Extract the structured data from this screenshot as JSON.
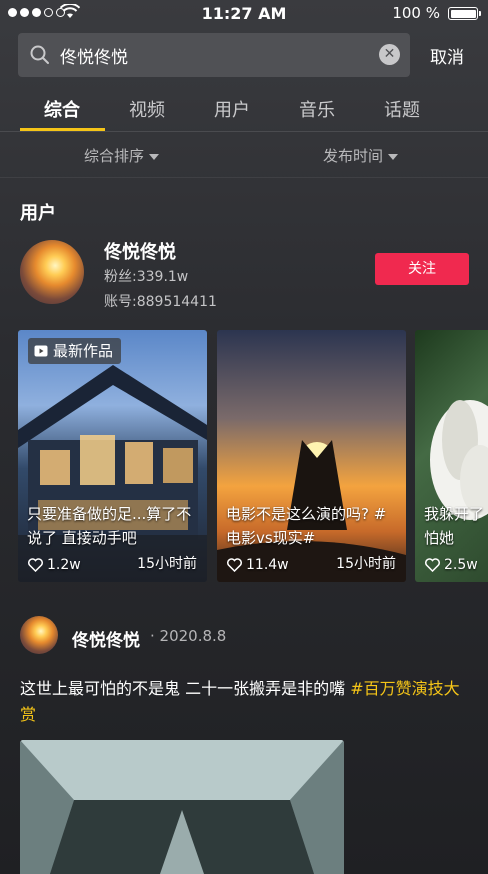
{
  "status_bar": {
    "time": "11:27 AM",
    "battery": "100 %"
  },
  "search": {
    "query": "佟悦佟悦",
    "cancel_label": "取消"
  },
  "tabs": [
    {
      "label": "综合",
      "active": true
    },
    {
      "label": "视频",
      "active": false
    },
    {
      "label": "用户",
      "active": false
    },
    {
      "label": "音乐",
      "active": false
    },
    {
      "label": "话题",
      "active": false
    }
  ],
  "filters": {
    "sort_label": "综合排序",
    "time_label": "发布时间"
  },
  "users_section": {
    "title": "用户",
    "user": {
      "name": "佟悦佟悦",
      "fans": "粉丝:339.1w",
      "account": "账号:889514411",
      "follow_label": "关注"
    }
  },
  "video_cards": [
    {
      "badge": "最新作品",
      "caption": "只要准备做的足...算了不说了 直接动手吧",
      "likes": "1.2w",
      "ago": "15小时前"
    },
    {
      "caption": "电影不是这么演的吗? #电影vs现实#",
      "likes": "11.4w",
      "ago": "15小时前"
    },
    {
      "caption": "我躲开了怕她",
      "likes": "2.5w",
      "ago": ""
    }
  ],
  "post": {
    "author": "佟悦佟悦",
    "date": "· 2020.8.8",
    "text": "这世上最可怕的不是鬼 二十一张搬弄是非的嘴 ",
    "hashtag": "#百万赞演技大赏"
  },
  "colors": {
    "accent": "#f5c518",
    "follow": "#f0294f"
  }
}
